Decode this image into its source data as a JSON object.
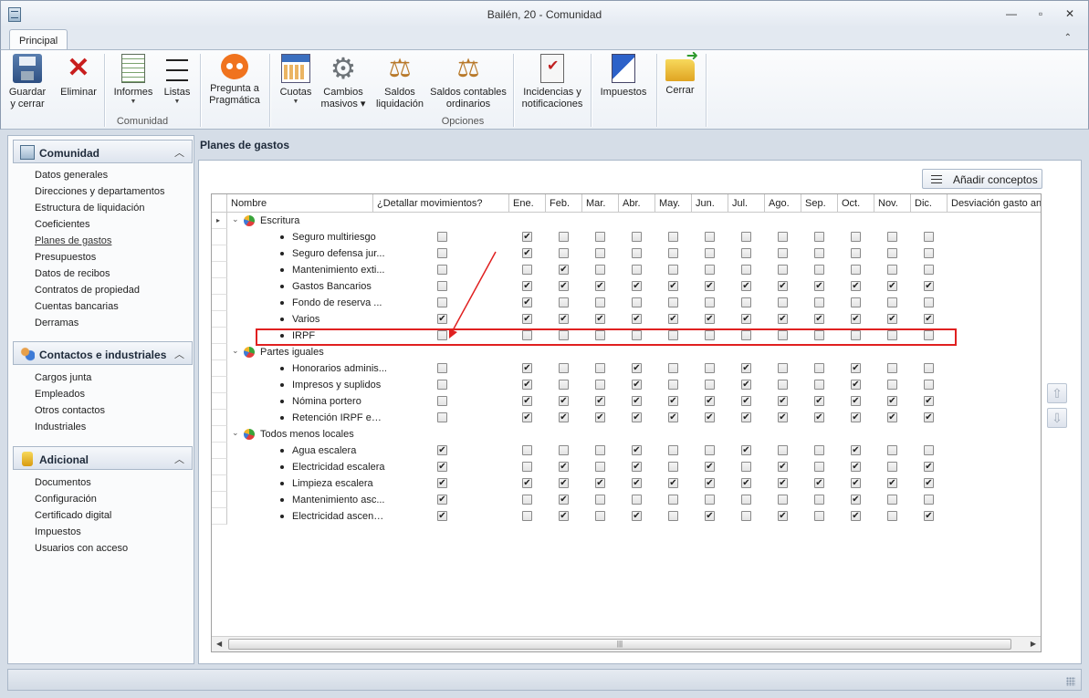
{
  "window": {
    "title": "Bailén, 20 - Comunidad",
    "minimize": "—",
    "maximize": "▫",
    "close": "✕"
  },
  "ribbon": {
    "tab": "Principal",
    "collapse": "⌃",
    "buttons": {
      "save": [
        "Guardar",
        "y cerrar"
      ],
      "delete": "Eliminar",
      "reports": "Informes",
      "lists": "Listas",
      "ask": [
        "Pregunta a",
        "Pragmática"
      ],
      "fees": "Cuotas",
      "bulk": [
        "Cambios",
        "masivos"
      ],
      "settlement": [
        "Saldos",
        "liquidación"
      ],
      "accounting": [
        "Saldos contables",
        "ordinarios"
      ],
      "incidents": [
        "Incidencias y",
        "notificaciones"
      ],
      "taxes": "Impuestos",
      "close": "Cerrar"
    },
    "groups": {
      "community": "Comunidad",
      "options": "Opciones"
    }
  },
  "sidebar": {
    "sections": [
      {
        "title": "Comunidad",
        "items": [
          "Datos generales",
          "Direcciones y departamentos",
          "Estructura de liquidación",
          "Coeficientes",
          "Planes de gastos",
          "Presupuestos",
          "Datos de recibos",
          "Contratos de propiedad",
          "Cuentas bancarias",
          "Derramas"
        ]
      },
      {
        "title": "Contactos e industriales",
        "items": [
          "Cargos junta",
          "Empleados",
          "Otros contactos",
          "Industriales"
        ]
      },
      {
        "title": "Adicional",
        "items": [
          "Documentos",
          "Configuración",
          "Certificado digital",
          "Impuestos",
          "Usuarios con acceso"
        ]
      }
    ],
    "active_item": "Planes de gastos"
  },
  "main": {
    "title": "Planes de gastos",
    "add_button": "Añadir conceptos",
    "columns": [
      "Nombre",
      "¿Detallar movimientos?",
      "Ene.",
      "Feb.",
      "Mar.",
      "Abr.",
      "May.",
      "Jun.",
      "Jul.",
      "Ago.",
      "Sep.",
      "Oct.",
      "Nov.",
      "Dic.",
      "Desviación gasto an"
    ],
    "groups": [
      {
        "name": "Escritura",
        "items": [
          {
            "name": "Seguro multiriesgo",
            "detail": false,
            "months": [
              1,
              0,
              0,
              0,
              0,
              0,
              0,
              0,
              0,
              0,
              0,
              0
            ]
          },
          {
            "name": "Seguro defensa jur...",
            "detail": false,
            "months": [
              1,
              0,
              0,
              0,
              0,
              0,
              0,
              0,
              0,
              0,
              0,
              0
            ]
          },
          {
            "name": "Mantenimiento exti...",
            "detail": false,
            "months": [
              0,
              1,
              0,
              0,
              0,
              0,
              0,
              0,
              0,
              0,
              0,
              0
            ]
          },
          {
            "name": "Gastos Bancarios",
            "detail": false,
            "months": [
              1,
              1,
              1,
              1,
              1,
              1,
              1,
              1,
              1,
              1,
              1,
              1
            ]
          },
          {
            "name": "Fondo de reserva ...",
            "detail": false,
            "months": [
              1,
              0,
              0,
              0,
              0,
              0,
              0,
              0,
              0,
              0,
              0,
              0
            ]
          },
          {
            "name": "Varios",
            "detail": true,
            "months": [
              1,
              1,
              1,
              1,
              1,
              1,
              1,
              1,
              1,
              1,
              1,
              1
            ]
          },
          {
            "name": "IRPF",
            "detail": false,
            "months": [
              0,
              0,
              0,
              0,
              0,
              0,
              0,
              0,
              0,
              0,
              0,
              0
            ]
          }
        ]
      },
      {
        "name": "Partes iguales",
        "items": [
          {
            "name": "Honorarios adminis...",
            "detail": false,
            "months": [
              1,
              0,
              0,
              1,
              0,
              0,
              1,
              0,
              0,
              1,
              0,
              0
            ]
          },
          {
            "name": "Impresos y suplidos",
            "detail": false,
            "months": [
              1,
              0,
              0,
              1,
              0,
              0,
              1,
              0,
              0,
              1,
              0,
              0
            ]
          },
          {
            "name": "Nómina portero",
            "detail": false,
            "months": [
              1,
              1,
              1,
              1,
              1,
              1,
              1,
              1,
              1,
              1,
              1,
              1
            ]
          },
          {
            "name": "Retención IRPF em...",
            "detail": false,
            "months": [
              1,
              1,
              1,
              1,
              1,
              1,
              1,
              1,
              1,
              1,
              1,
              1
            ]
          }
        ]
      },
      {
        "name": "Todos menos locales",
        "items": [
          {
            "name": "Agua escalera",
            "detail": true,
            "months": [
              0,
              0,
              0,
              1,
              0,
              0,
              1,
              0,
              0,
              1,
              0,
              0
            ]
          },
          {
            "name": "Electricidad escalera",
            "detail": true,
            "months": [
              0,
              1,
              0,
              1,
              0,
              1,
              0,
              1,
              0,
              1,
              0,
              1
            ]
          },
          {
            "name": "Limpieza escalera",
            "detail": true,
            "months": [
              1,
              1,
              1,
              1,
              1,
              1,
              1,
              1,
              1,
              1,
              1,
              1
            ]
          },
          {
            "name": "Mantenimiento asc...",
            "detail": true,
            "months": [
              0,
              1,
              0,
              0,
              0,
              0,
              0,
              0,
              0,
              1,
              0,
              0
            ]
          },
          {
            "name": "Electricidad ascensor",
            "detail": true,
            "months": [
              0,
              1,
              0,
              1,
              0,
              1,
              0,
              1,
              0,
              1,
              0,
              1
            ]
          }
        ]
      }
    ]
  },
  "accent_colors": {
    "highlight": "#e02020",
    "ribbon_border": "#a9b7c8"
  }
}
